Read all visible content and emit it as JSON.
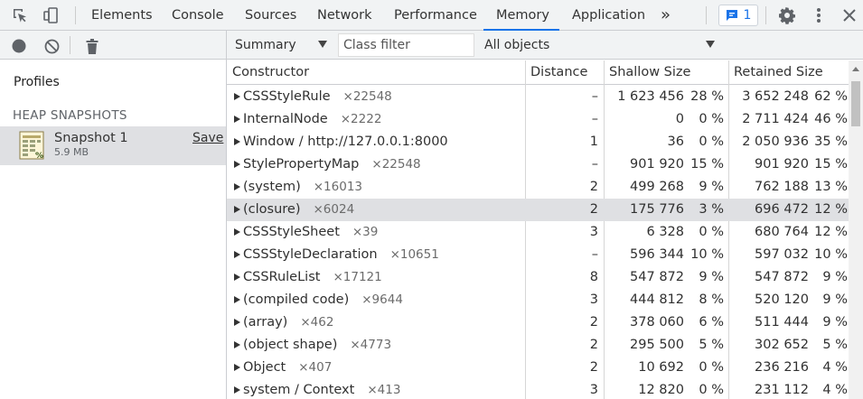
{
  "tabs": [
    {
      "label": "Elements"
    },
    {
      "label": "Console"
    },
    {
      "label": "Sources"
    },
    {
      "label": "Network"
    },
    {
      "label": "Performance"
    },
    {
      "label": "Memory"
    },
    {
      "label": "Application"
    }
  ],
  "active_tab": "Memory",
  "more_tabs": "»",
  "issues_count": "1",
  "left": {
    "profiles_heading": "Profiles",
    "section_title": "HEAP SNAPSHOTS",
    "snapshot": {
      "name": "Snapshot 1",
      "size": "5.9 MB",
      "save_label": "Save"
    }
  },
  "toolbar": {
    "view": "Summary",
    "class_filter_placeholder": "Class filter",
    "objects": "All objects"
  },
  "columns": {
    "constructor": "Constructor",
    "distance": "Distance",
    "shallow": "Shallow Size",
    "retained": "Retained Size"
  },
  "rows": [
    {
      "name": "CSSStyleRule",
      "count": "×22548",
      "distance": "–",
      "shallow": "1 623 456",
      "shallow_pct": "28 %",
      "retained": "3 652 248",
      "retained_pct": "62 %"
    },
    {
      "name": "InternalNode",
      "count": "×2222",
      "distance": "–",
      "shallow": "0",
      "shallow_pct": "0 %",
      "retained": "2 711 424",
      "retained_pct": "46 %"
    },
    {
      "name": "Window / http://127.0.0.1:8000",
      "count": "",
      "distance": "1",
      "shallow": "36",
      "shallow_pct": "0 %",
      "retained": "2 050 936",
      "retained_pct": "35 %"
    },
    {
      "name": "StylePropertyMap",
      "count": "×22548",
      "distance": "–",
      "shallow": "901 920",
      "shallow_pct": "15 %",
      "retained": "901 920",
      "retained_pct": "15 %"
    },
    {
      "name": "(system)",
      "count": "×16013",
      "distance": "2",
      "shallow": "499 268",
      "shallow_pct": "9 %",
      "retained": "762 188",
      "retained_pct": "13 %"
    },
    {
      "name": "(closure)",
      "count": "×6024",
      "distance": "2",
      "shallow": "175 776",
      "shallow_pct": "3 %",
      "retained": "696 472",
      "retained_pct": "12 %",
      "selected": true
    },
    {
      "name": "CSSStyleSheet",
      "count": "×39",
      "distance": "3",
      "shallow": "6 328",
      "shallow_pct": "0 %",
      "retained": "680 764",
      "retained_pct": "12 %"
    },
    {
      "name": "CSSStyleDeclaration",
      "count": "×10651",
      "distance": "–",
      "shallow": "596 344",
      "shallow_pct": "10 %",
      "retained": "597 032",
      "retained_pct": "10 %"
    },
    {
      "name": "CSSRuleList",
      "count": "×17121",
      "distance": "8",
      "shallow": "547 872",
      "shallow_pct": "9 %",
      "retained": "547 872",
      "retained_pct": "9 %"
    },
    {
      "name": "(compiled code)",
      "count": "×9644",
      "distance": "3",
      "shallow": "444 812",
      "shallow_pct": "8 %",
      "retained": "520 120",
      "retained_pct": "9 %"
    },
    {
      "name": "(array)",
      "count": "×462",
      "distance": "2",
      "shallow": "378 060",
      "shallow_pct": "6 %",
      "retained": "511 444",
      "retained_pct": "9 %"
    },
    {
      "name": "(object shape)",
      "count": "×4773",
      "distance": "2",
      "shallow": "295 500",
      "shallow_pct": "5 %",
      "retained": "302 652",
      "retained_pct": "5 %"
    },
    {
      "name": "Object",
      "count": "×407",
      "distance": "2",
      "shallow": "10 692",
      "shallow_pct": "0 %",
      "retained": "236 216",
      "retained_pct": "4 %"
    },
    {
      "name": "system / Context",
      "count": "×413",
      "distance": "3",
      "shallow": "12 820",
      "shallow_pct": "0 %",
      "retained": "231 112",
      "retained_pct": "4 %"
    }
  ],
  "colors": {
    "accent": "#1a73e8",
    "selected_row": "#dfe0e3",
    "toolbar_bg": "#f1f3f4"
  }
}
